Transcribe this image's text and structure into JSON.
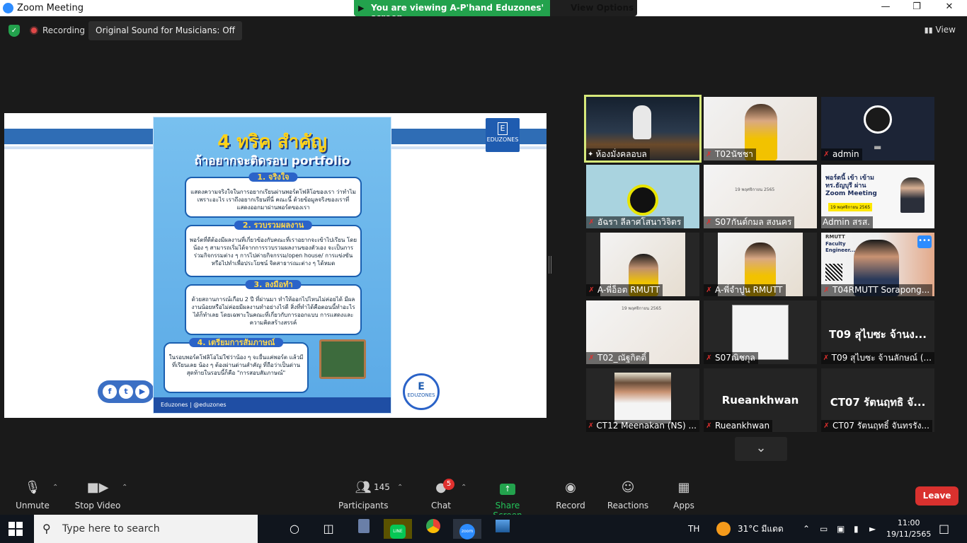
{
  "window": {
    "title": "Zoom Meeting",
    "minimize": "—",
    "restore": "❐",
    "close": "✕"
  },
  "viewing_banner": {
    "text": "You are viewing A-P'hand Eduzones' screen",
    "view_options": "View Options ⌄"
  },
  "topbar": {
    "recording": "Recording",
    "original_sound": "Original Sound for Musicians: Off",
    "view": "View"
  },
  "poster": {
    "title": "4 ทริค สำคัญ",
    "subtitle": "ถ้าอยากจะติดรอบ portfolio",
    "cards": [
      {
        "head": "1. จริงใจ",
        "body": "แสดงความจริงใจในการอยากเรียนผ่านพอร์ตโฟลิโอของเรา ว่าทำไม เพราะอะไร เราถึงอยากเรียนที่นี่ คณะนี้ ด้วยข้อมูลจริงของเราที่แสดงออกมาผ่านพอร์ตของเรา"
      },
      {
        "head": "2. รวบรวมผลงาน",
        "body": "พอร์ตที่ดีต้องมีผลงานที่เกี่ยวข้องกับคณะที่เราอยากจะเข้าไปเรียน โดยน้อง ๆ สามารถเริ่มได้จากการรวบรวมผลงานของตัวเอง จะเป็นการร่วมกิจกรรมต่าง ๆ การไปค่ายกิจกรรม/open house/ การแข่งขันหรือไปทำเพื่อประโยชน์ จิตสาธารณะต่าง ๆ ได้หมด"
      },
      {
        "head": "3. ลงมือทำ",
        "body": "ด้วยสถานการณ์เกือบ 2 ปี ที่ผ่านมา ทำให้ออกไปไหนไม่ค่อยได้ มีผลงานน้อยหรือไม่ค่อยมีผลงานทำอย่างไรดี สิ่งที่ทำได้คือตอนนี้ทำอะไรได้ก็ทำเลย โดยเฉพาะในคณะที่เกี่ยวกับการออกแบบ การแสดงและความคิดสร้างสรรค์"
      },
      {
        "head": "4. เตรียมการสัมภาษณ์",
        "body": "ในรอบพอร์ตโฟลิโอไม่ใช่ว่าน้อง ๆ จะยื่นแค่พอร์ต แล้วมีที่เรียนเลย น้อง ๆ ต้องผ่านด่านสำคัญ ที่ถือว่าเป็นด่านสุดท้ายในรอบนี้ก็คือ \"การสอบสัมภาษณ์\""
      }
    ],
    "footer": "Eduzones  |  @eduzones",
    "logo_text": "EDUZONES",
    "logo_letter": "E"
  },
  "participants_grid": [
    {
      "name": "ห้องมั่งคลอบล",
      "muted": false,
      "pinned": true
    },
    {
      "name": "T02นัชชา",
      "muted": true
    },
    {
      "name": "admin",
      "muted": true
    },
    {
      "name": "อัฉรา ลีลาศโสนาวิจิตร",
      "muted": true
    },
    {
      "name": "S07กันต์กมล สงนคร",
      "muted": true
    },
    {
      "name": "Admin สรส.",
      "muted": false
    },
    {
      "name": "A-พี่อ็อต RMUTT",
      "muted": true
    },
    {
      "name": "A-พี่จำปูน RMUTT",
      "muted": true
    },
    {
      "name": "T04RMUTT Sorapong...",
      "muted": true
    },
    {
      "name": "T02_ณัฐกิตติ์",
      "muted": true
    },
    {
      "name": "S07ณิชกุล",
      "muted": true
    },
    {
      "name": "T09 สุไบซะ จ้านลักษณ์ (...",
      "muted": true,
      "big": "T09 สุไบซะ จ้านง..."
    },
    {
      "name": "CT12 Meenakan (NS) ...",
      "muted": true
    },
    {
      "name": "Rueankhwan",
      "muted": true,
      "big": "Rueankhwan"
    },
    {
      "name": "CT07 รัตนฤทธิ์ จันทรรัง...",
      "muted": true,
      "big": "CT07 รัตนฤทธิ จั..."
    }
  ],
  "tile_text": {
    "faculty": "Faculty Engineer...",
    "rmutt": "RMUTT",
    "zoom_card": "พอร์ตนี้ เข้า เข้ามทร.ธัญบุรี ผ่าน Zoom Meeting",
    "date": "19 พฤศจิกายน 2565"
  },
  "toolbar": {
    "unmute": "Unmute",
    "stop_video": "Stop Video",
    "participants": "Participants",
    "participants_count": "145",
    "chat": "Chat",
    "chat_badge": "5",
    "share_screen": "Share Screen",
    "record": "Record",
    "reactions": "Reactions",
    "apps": "Apps",
    "leave": "Leave"
  },
  "taskbar": {
    "search_placeholder": "Type here to search",
    "lang": "TH",
    "weather": "31°C  มีแดด",
    "time": "11:00",
    "date": "19/11/2565"
  },
  "colors": {
    "accent_green": "#23a24d",
    "leave_red": "#d9312e",
    "zoom_blue": "#2D8CFF"
  }
}
